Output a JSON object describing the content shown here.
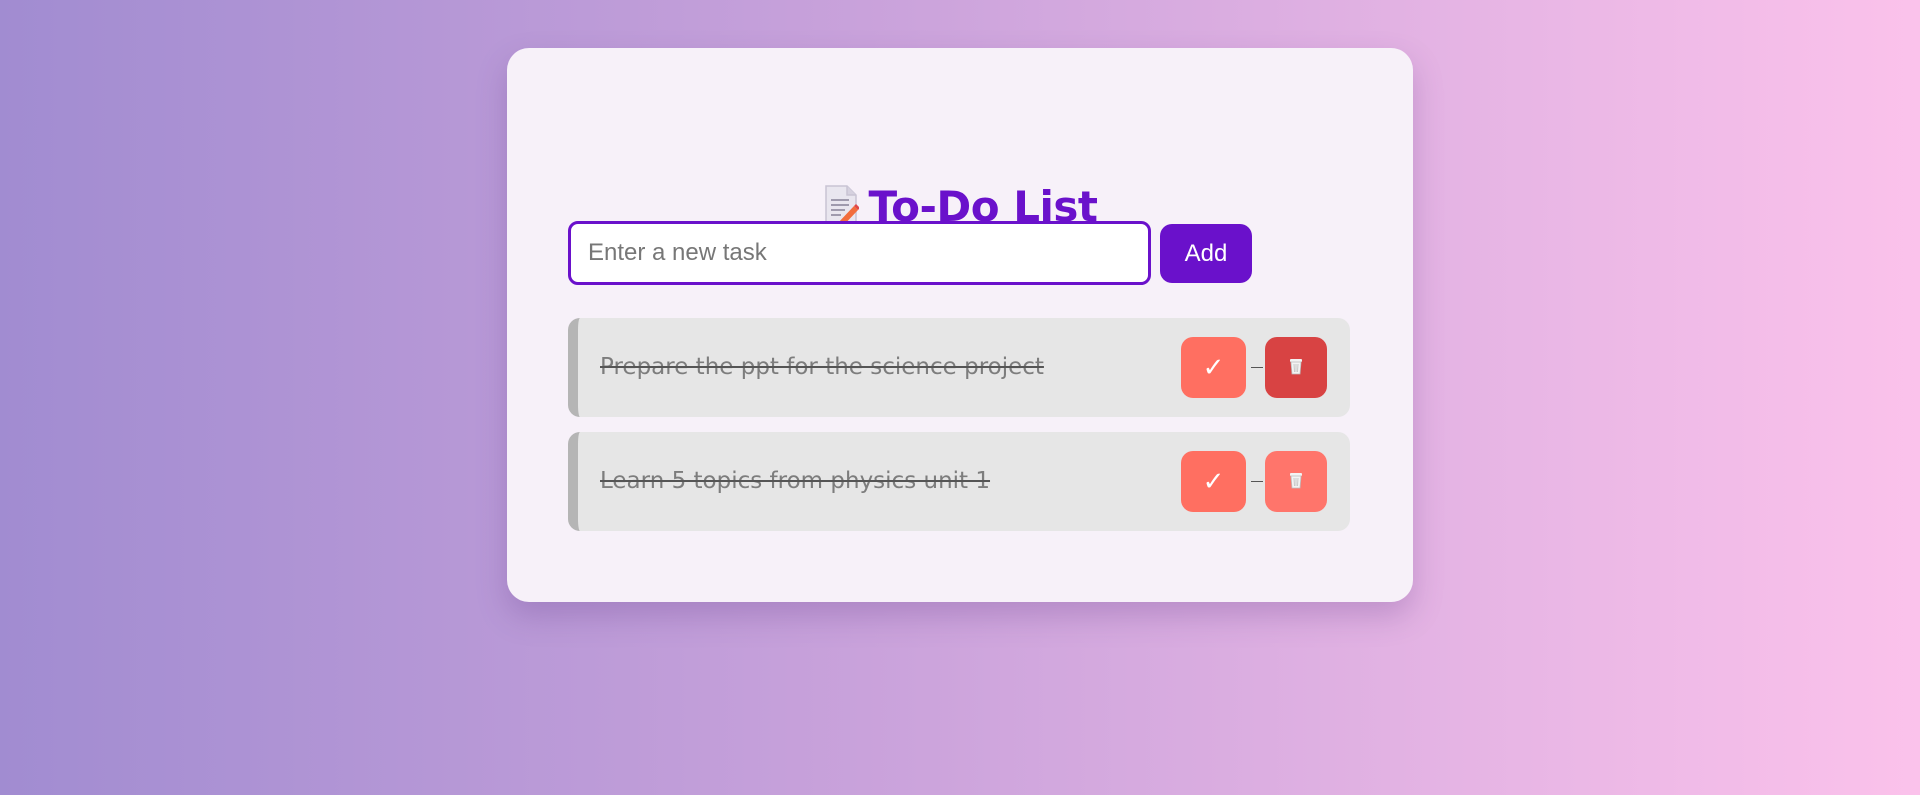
{
  "header": {
    "title_icon": "memo-icon",
    "title": "To-Do List"
  },
  "form": {
    "input_value": "",
    "input_placeholder": "Enter a new task",
    "add_label": "Add"
  },
  "tasks": [
    {
      "text": "Prepare the ppt for the science project",
      "completed": true,
      "complete_icon": "checkmark-icon",
      "complete_glyph": "✓",
      "delete_icon": "trash-can-icon"
    },
    {
      "text": "Learn 5 topics from physics unit 1",
      "completed": true,
      "complete_icon": "checkmark-icon",
      "complete_glyph": "✓",
      "delete_icon": "trash-can-icon"
    }
  ],
  "colors": {
    "accent": "#6a11cb",
    "complete_button": "#ff6f61",
    "delete_button": "#ff756b",
    "delete_button_hover": "#d84343",
    "task_background": "#e6e6e6",
    "card_background": "#f7f1f9"
  }
}
